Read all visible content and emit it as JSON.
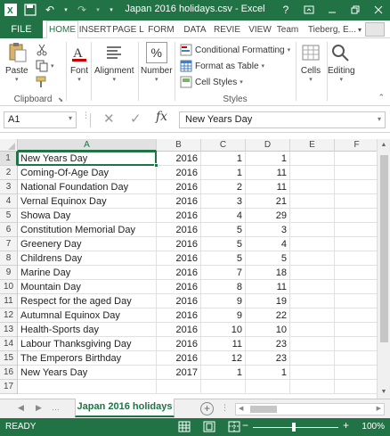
{
  "window": {
    "title": "Japan 2016 holidays.csv - Excel",
    "help_label": "?"
  },
  "tabs": {
    "file": "FILE",
    "items": [
      "HOME",
      "INSERT",
      "PAGE L",
      "FORM",
      "DATA",
      "REVIE",
      "VIEW",
      "Team"
    ],
    "active": "HOME",
    "user": "Tieberg, E...",
    "user_caret": "▾"
  },
  "ribbon": {
    "clipboard": {
      "paste": "Paste",
      "group": "Clipboard"
    },
    "font": {
      "label": "Font"
    },
    "alignment": {
      "label": "Alignment"
    },
    "number": {
      "label": "Number",
      "icon_text": "%"
    },
    "styles": {
      "conditional": "Conditional Formatting",
      "format_table": "Format as Table",
      "cell_styles": "Cell Styles",
      "group": "Styles"
    },
    "cells": {
      "label": "Cells"
    },
    "editing": {
      "label": "Editing"
    }
  },
  "formula_bar": {
    "name_box": "A1",
    "fx": "fx",
    "content": "New Years Day"
  },
  "columns": [
    "A",
    "B",
    "C",
    "D",
    "E",
    "F"
  ],
  "selected_column": "A",
  "rows": [
    {
      "n": "1",
      "a": "New Years Day",
      "b": "2016",
      "c": "1",
      "d": "1"
    },
    {
      "n": "2",
      "a": "Coming-Of-Age Day",
      "b": "2016",
      "c": "1",
      "d": "11"
    },
    {
      "n": "3",
      "a": "National Foundation Day",
      "b": "2016",
      "c": "2",
      "d": "11"
    },
    {
      "n": "4",
      "a": "Vernal Equinox Day",
      "b": "2016",
      "c": "3",
      "d": "21"
    },
    {
      "n": "5",
      "a": "Showa Day",
      "b": "2016",
      "c": "4",
      "d": "29"
    },
    {
      "n": "6",
      "a": "Constitution Memorial Day",
      "b": "2016",
      "c": "5",
      "d": "3"
    },
    {
      "n": "7",
      "a": "Greenery Day",
      "b": "2016",
      "c": "5",
      "d": "4"
    },
    {
      "n": "8",
      "a": "Childrens Day",
      "b": "2016",
      "c": "5",
      "d": "5"
    },
    {
      "n": "9",
      "a": "Marine Day",
      "b": "2016",
      "c": "7",
      "d": "18"
    },
    {
      "n": "10",
      "a": "Mountain Day",
      "b": "2016",
      "c": "8",
      "d": "11"
    },
    {
      "n": "11",
      "a": "Respect for the aged Day",
      "b": "2016",
      "c": "9",
      "d": "19"
    },
    {
      "n": "12",
      "a": "Autumnal Equinox Day",
      "b": "2016",
      "c": "9",
      "d": "22"
    },
    {
      "n": "13",
      "a": "Health-Sports day",
      "b": "2016",
      "c": "10",
      "d": "10"
    },
    {
      "n": "14",
      "a": "Labour Thanksgiving Day",
      "b": "2016",
      "c": "11",
      "d": "23"
    },
    {
      "n": "15",
      "a": "The Emperors Birthday",
      "b": "2016",
      "c": "12",
      "d": "23"
    },
    {
      "n": "16",
      "a": "New Years Day",
      "b": "2017",
      "c": "1",
      "d": "1"
    },
    {
      "n": "17",
      "a": "",
      "b": "",
      "c": "",
      "d": ""
    }
  ],
  "sheet_tab": "Japan 2016 holidays",
  "add_sheet": "+",
  "status": {
    "ready": "READY",
    "zoom": "100%",
    "zoom_minus": "−",
    "zoom_plus": "+"
  },
  "colors": {
    "accent": "#217346"
  }
}
